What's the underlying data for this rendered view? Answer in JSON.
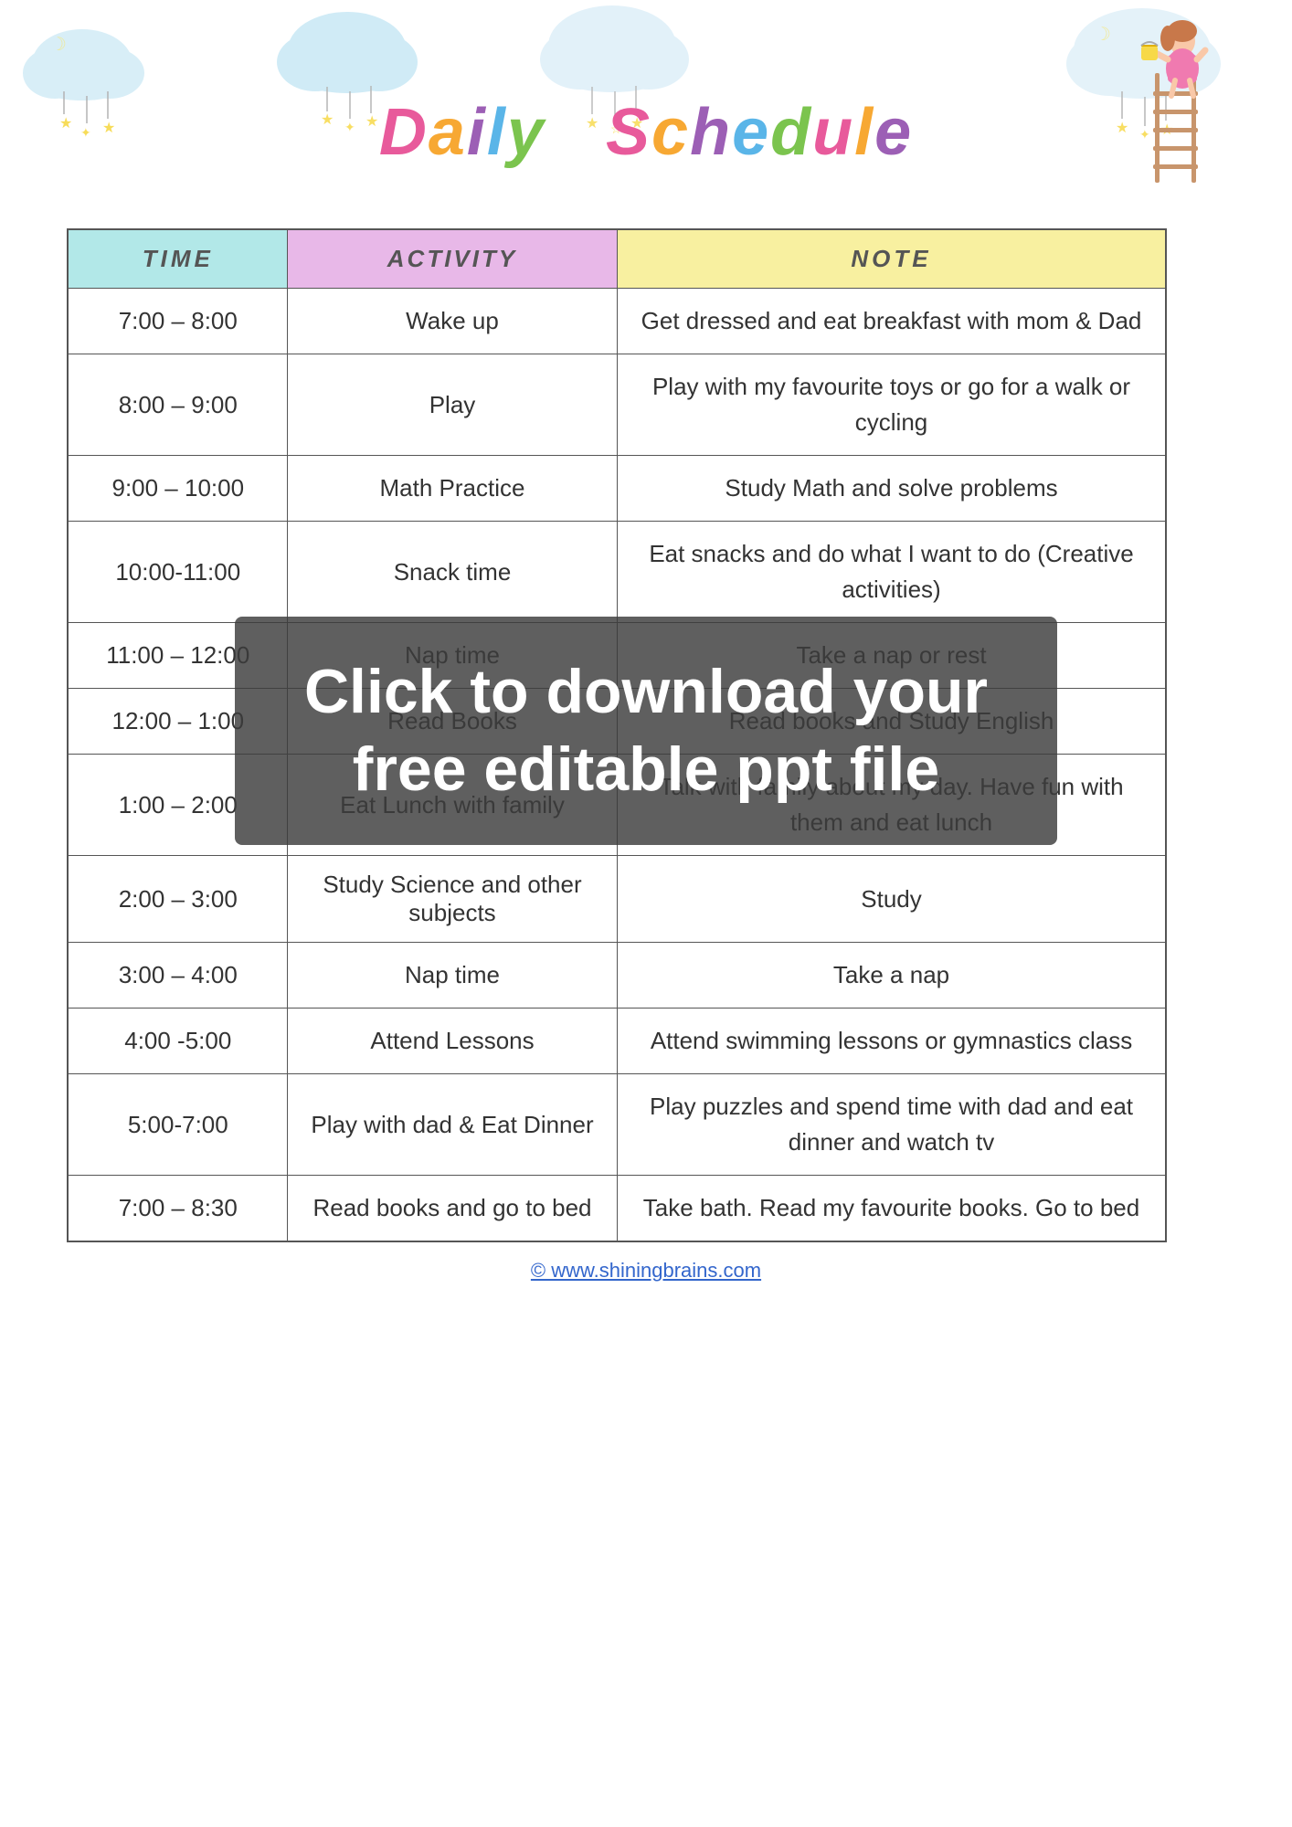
{
  "page": {
    "title": "Daily Schedule",
    "footer_link": "© www.shiningbrains.com",
    "watermark": "Click to download your free editable ppt file"
  },
  "header": {
    "title_part1": "Daily",
    "title_part2": "Schedule"
  },
  "table": {
    "headers": {
      "time": "TIME",
      "activity": "ACTIVITY",
      "note": "NOTE"
    },
    "rows": [
      {
        "time": "7:00 – 8:00",
        "activity": "Wake up",
        "note": "Get dressed and eat breakfast with mom & Dad"
      },
      {
        "time": "8:00 – 9:00",
        "activity": "Play",
        "note": "Play with my favourite toys or go for a walk or cycling"
      },
      {
        "time": "9:00 – 10:00",
        "activity": "Math Practice",
        "note": "Study Math and solve problems"
      },
      {
        "time": "10:00-11:00",
        "activity": "Snack time",
        "note": "Eat snacks and do what I want to do (Creative activities)"
      },
      {
        "time": "11:00 – 12:00",
        "activity": "Nap time",
        "note": "Take a nap or rest"
      },
      {
        "time": "12:00 – 1:00",
        "activity": "Read Books",
        "note": "Read books and Study English"
      },
      {
        "time": "1:00 – 2:00",
        "activity": "Eat Lunch with family",
        "note": "Talk with family about my day. Have fun with them and eat lunch"
      },
      {
        "time": "2:00 – 3:00",
        "activity": "Study Science and other subjects",
        "note": "Study"
      },
      {
        "time": "3:00 – 4:00",
        "activity": "Nap time",
        "note": "Take a nap"
      },
      {
        "time": "4:00 -5:00",
        "activity": "Attend Lessons",
        "note": "Attend swimming lessons or gymnastics class"
      },
      {
        "time": "5:00-7:00",
        "activity": "Play with dad & Eat Dinner",
        "note": "Play puzzles and spend time with dad and eat dinner and watch tv"
      },
      {
        "time": "7:00 – 8:30",
        "activity": "Read books and go to bed",
        "note": "Take bath. Read my favourite books. Go to bed"
      }
    ]
  }
}
